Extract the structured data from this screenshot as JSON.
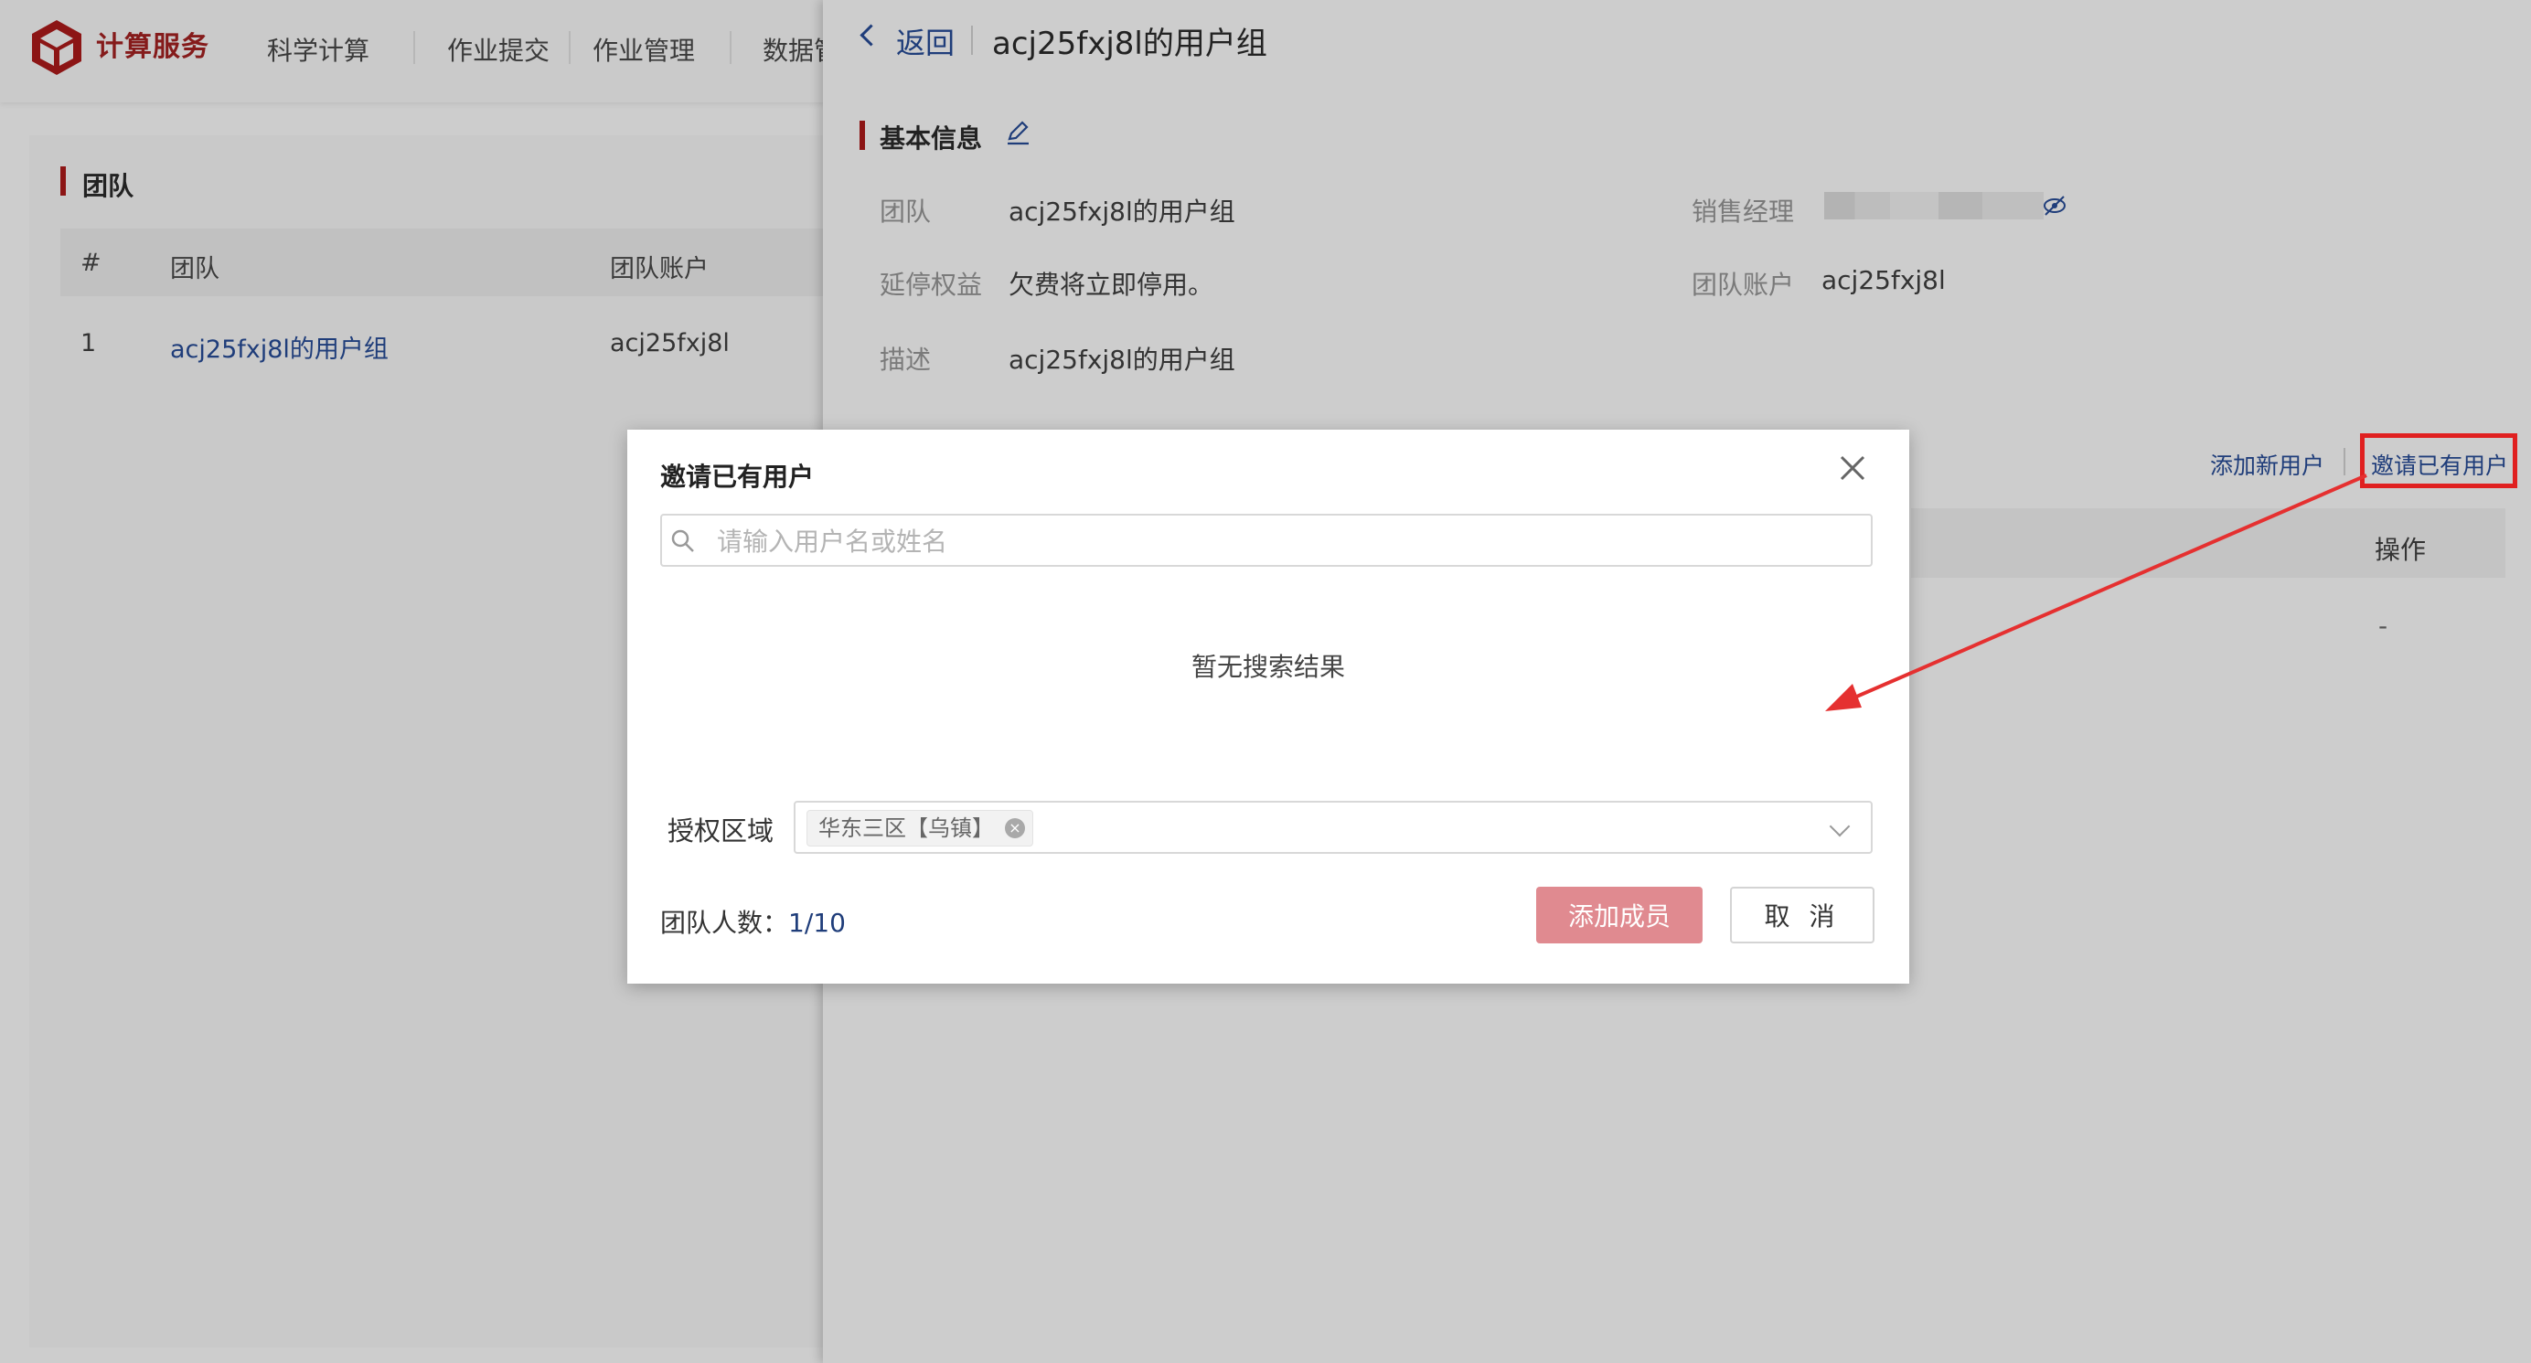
{
  "brand": "计算服务",
  "nav": [
    "科学计算",
    "作业提交",
    "作业管理",
    "数据管"
  ],
  "left": {
    "title": "团队",
    "columns": [
      "#",
      "团队",
      "团队账户"
    ],
    "rows": [
      [
        "1",
        "acj25fxj8l的用户组",
        "acj25fxj8l"
      ]
    ]
  },
  "panel": {
    "back": "返回",
    "title": "acj25fxj8l的用户组",
    "section": "基本信息",
    "fields": {
      "team_label": "团队",
      "team_value": "acj25fxj8l的用户组",
      "extend_label": "延停权益",
      "extend_value": "欠费将立即停用。",
      "desc_label": "描述",
      "desc_value": "acj25fxj8l的用户组",
      "manager_label": "销售经理",
      "account_label": "团队账户",
      "account_value": "acj25fxj8l"
    },
    "actions": {
      "add_new": "添加新用户",
      "invite": "邀请已有用户"
    },
    "table_op": "操作",
    "row_op": "-"
  },
  "modal": {
    "title": "邀请已有用户",
    "search_placeholder": "请输入用户名或姓名",
    "empty": "暂无搜索结果",
    "region_label": "授权区域",
    "region_tag": "华东三区【乌镇】",
    "count_label": "团队人数：",
    "count_value": "1/10",
    "add_button": "添加成员",
    "cancel_button": "取 消"
  },
  "colors": {
    "brand": "#851b1b",
    "link": "#1f3d7a",
    "primary_disabled": "#e08a90",
    "highlight": "#e02020"
  }
}
